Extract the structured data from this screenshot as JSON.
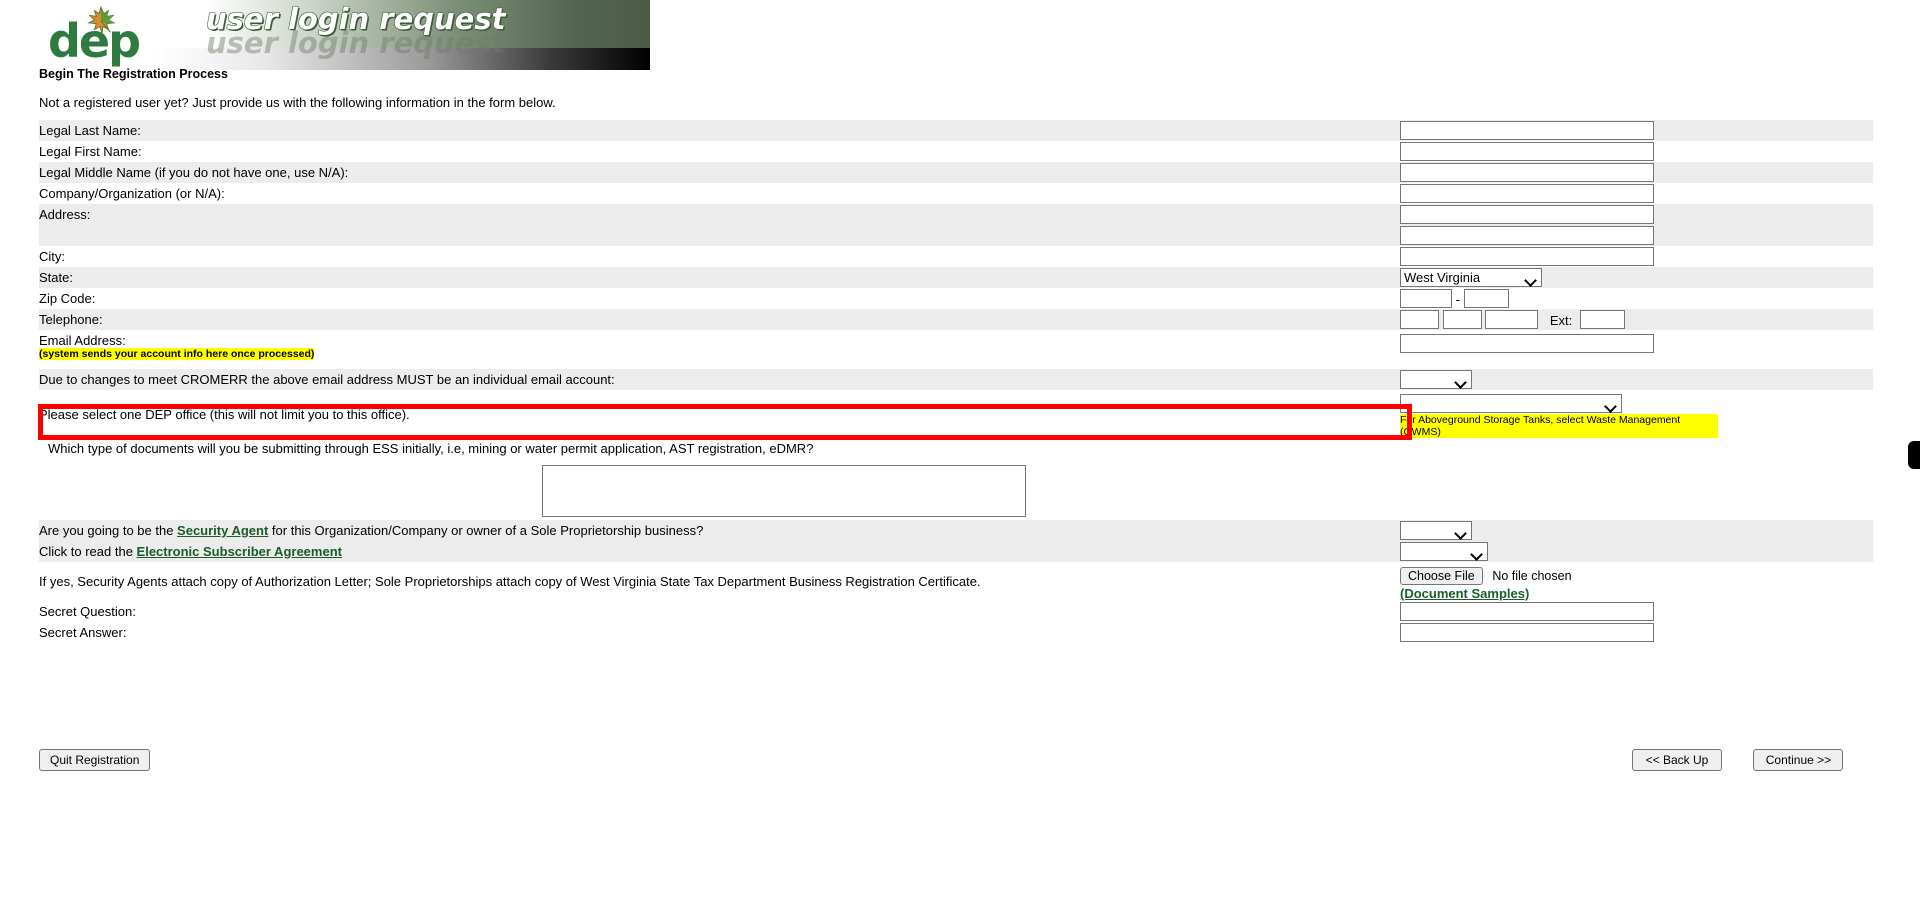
{
  "banner": {
    "title": "user login request",
    "logo_text": "dep",
    "logo_icon": "maple-leaf-icon"
  },
  "intro": {
    "heading": "Begin The Registration Process",
    "paragraph": "Not a registered user yet? Just provide us with the following information in the form below."
  },
  "form": {
    "labels": {
      "legal_last_name": "Legal Last Name:",
      "legal_first_name": "Legal First Name:",
      "legal_middle_name": "Legal Middle Name (if you do not have one, use N/A):",
      "company": "Company/Organization (or N/A):",
      "address": "Address:",
      "address2": "",
      "city": "City:",
      "state": "State:",
      "zip": "Zip Code:",
      "telephone": "Telephone:",
      "email": "Email Address:",
      "email_note": "(system sends your account info here once processed)",
      "cromerr": "Due to changes to meet CROMERR the above email address MUST be an individual email account:",
      "dep_office": "Please select one DEP office (this will not limit you to this office).",
      "dep_office_note": "For Aboveground Storage Tanks, select Waste Management (OWMS)",
      "doc_types": "Which type of documents will you be submitting through ESS initially, i.e, mining or water permit application, AST registration, eDMR?",
      "security_agent_pre": "Are you going to be the ",
      "security_agent_link": "Security Agent",
      "security_agent_post": " for this Organization/Company or owner of a Sole Proprietorship business?",
      "subscriber_pre": "Click to read the ",
      "subscriber_link": "Electronic Subscriber Agreement",
      "attach": "If yes, Security Agents attach copy of Authorization Letter; Sole Proprietorships attach copy of West Virginia State Tax Department Business Registration Certificate.",
      "secret_question": "Secret Question:",
      "secret_answer": "Secret Answer:"
    },
    "values": {
      "legal_last_name": "",
      "legal_first_name": "",
      "legal_middle_name": "",
      "company": "",
      "address1": "",
      "address2": "",
      "city": "",
      "state": "West Virginia",
      "zip1": "",
      "zip2": "",
      "zip_separator": "-",
      "tel1": "",
      "tel2": "",
      "tel3": "",
      "ext_label": "Ext:",
      "ext": "",
      "email": "",
      "cromerr_select": "",
      "dep_office_select": "",
      "doc_types_text": "",
      "security_agent_select": "",
      "subscriber_select": "",
      "secret_question": "",
      "secret_answer": ""
    },
    "file_upload": {
      "button_label": "Choose File",
      "status": "No file chosen",
      "samples_link": "(Document Samples)"
    }
  },
  "buttons": {
    "quit": "Quit Registration",
    "back": "<< Back Up",
    "continue": "Continue >>"
  },
  "annotation": {
    "highlight_color": "#ff0000",
    "target": "email-address-row"
  },
  "colors": {
    "band_gray": "#ececec",
    "band_white": "#ffffff",
    "link_green": "#1a5c2a",
    "highlight_yellow": "#ffff00",
    "banner_green": "#4b5b46"
  }
}
